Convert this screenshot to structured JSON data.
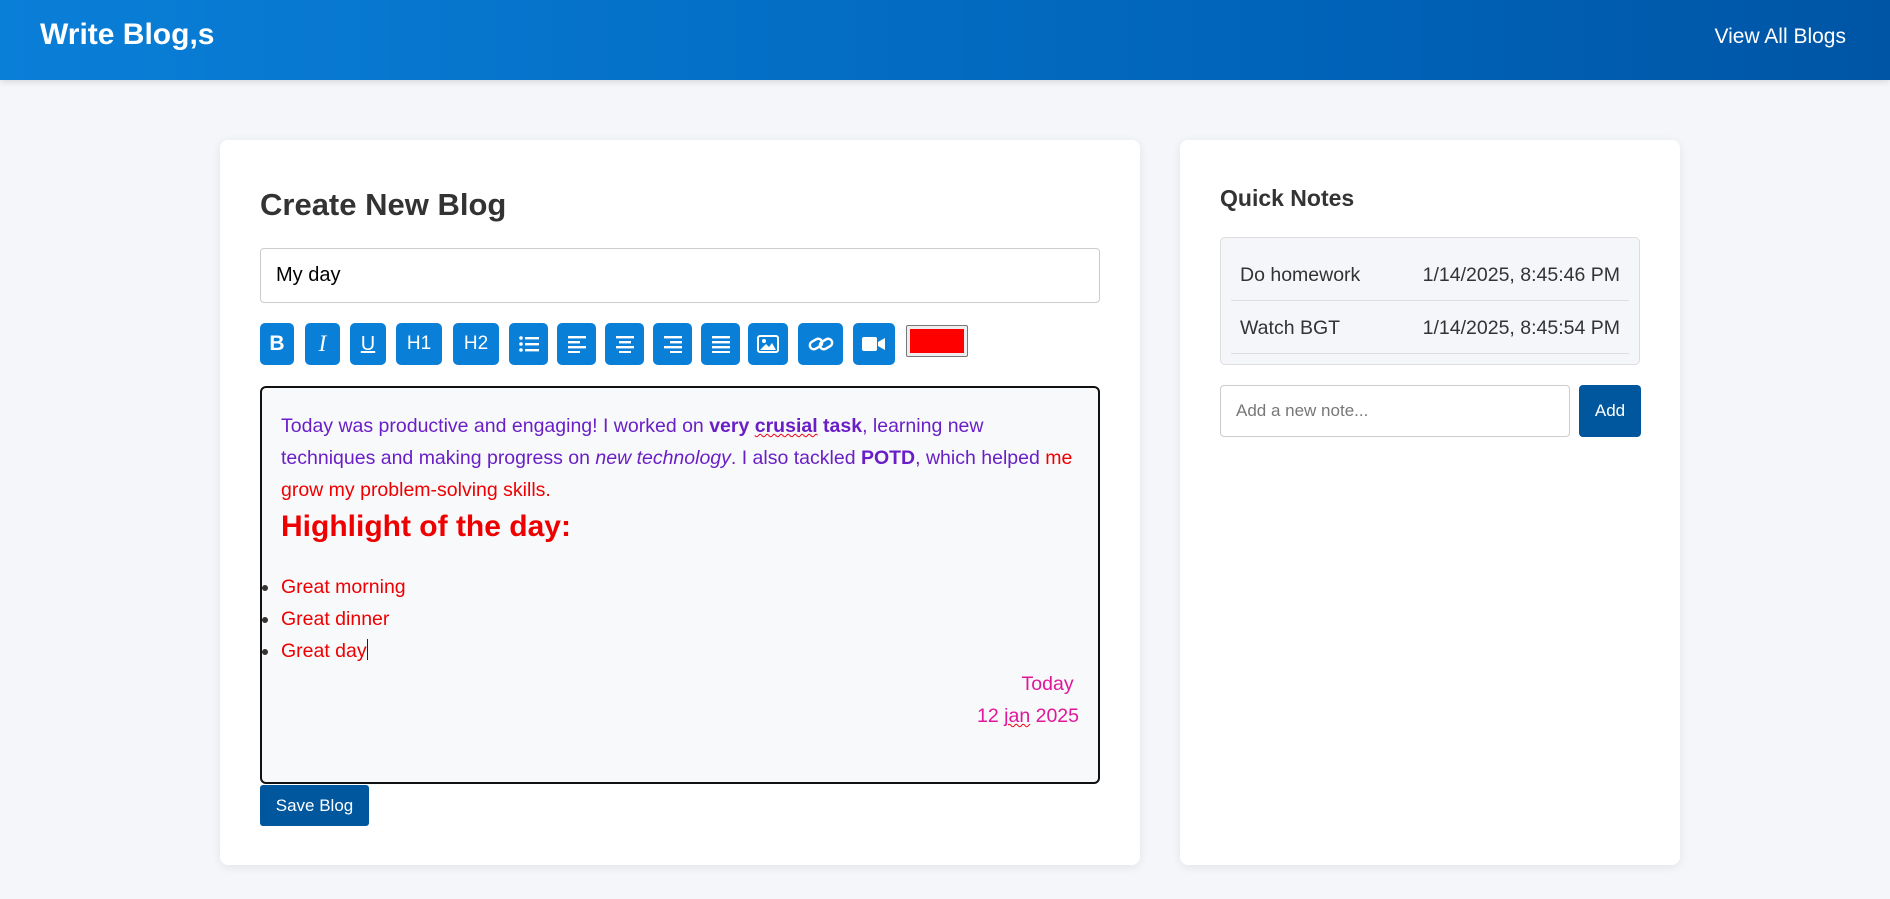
{
  "header": {
    "brand": "Write Blog,s",
    "view_all_label": "View All Blogs"
  },
  "editor": {
    "heading": "Create New Blog",
    "title_value": "My day",
    "toolbar": {
      "bold": "B",
      "italic": "I",
      "underline": "U",
      "h1": "H1",
      "h2": "H2",
      "icons": [
        "bold-icon",
        "italic-icon",
        "underline-icon",
        "list-icon",
        "align-left-icon",
        "align-center-icon",
        "align-right-icon",
        "align-justify-icon",
        "image-icon",
        "link-icon",
        "video-icon"
      ],
      "text_color": "#ff0000"
    },
    "content": {
      "p1_a": "Today was productive and engaging! I worked on ",
      "p1_b1": "very ",
      "p1_b2": "crusial",
      "p1_b3": " task",
      "p1_c": ", learning new techniques and making progress on ",
      "p1_i": "new technology",
      "p1_d": ". I also tackled ",
      "p1_potd": "POTD",
      "p1_e": ", which helped ",
      "p1_red": "me grow my problem-solving skills.",
      "highlight_heading": "Highlight of the day:",
      "list_items": [
        "Great morning",
        "Great dinner",
        "Great day"
      ],
      "date_line1": "Today",
      "date_line2_a": "12 ",
      "date_line2_b": "jan",
      "date_line2_c": " 2025"
    },
    "save_label": "Save Blog"
  },
  "notes": {
    "heading": "Quick Notes",
    "items": [
      {
        "text": "Do homework",
        "date": "1/14/2025, 8:45:46 PM"
      },
      {
        "text": "Watch BGT",
        "date": "1/14/2025, 8:45:54 PM"
      }
    ],
    "input_placeholder": "Add a new note...",
    "add_label": "Add"
  },
  "colors": {
    "primary": "#0a7fd8",
    "dark_button": "#00579e",
    "purple_text": "#6a1fc6",
    "red_text": "#ee0000",
    "pink_text": "#e0179b"
  }
}
